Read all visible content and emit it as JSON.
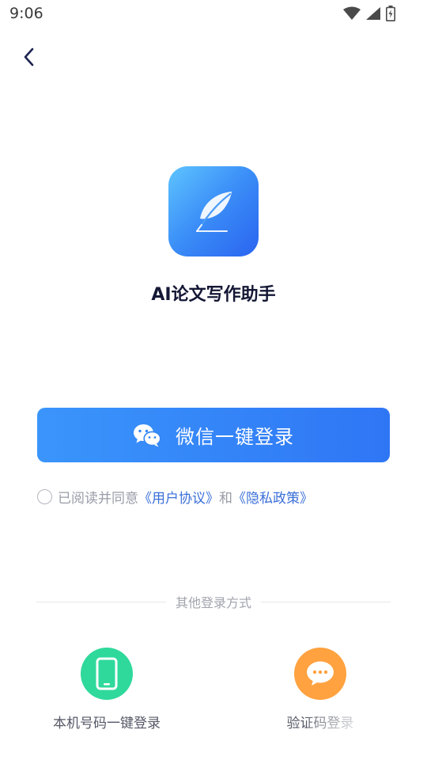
{
  "status_bar": {
    "time": "9:06",
    "icons": [
      "wifi-icon",
      "signal-icon",
      "battery-icon"
    ]
  },
  "nav": {
    "back_icon": "chevron-left-icon"
  },
  "app": {
    "name": "AI论文写作助手",
    "logo_icon": "feather-icon",
    "brand_color": "#3a8cf7"
  },
  "login": {
    "wechat_button_label": "微信一键登录",
    "wechat_icon": "wechat-icon"
  },
  "agreement": {
    "prefix": "已阅读并同意",
    "user_agreement": "《用户协议》",
    "conjunction": "和",
    "privacy_policy": "《隐私政策》",
    "checked": false
  },
  "other_login": {
    "divider_label": "其他登录方式",
    "options": [
      {
        "label": "本机号码一键登录",
        "icon": "phone-icon",
        "color": "#2fd99b"
      },
      {
        "label": "验证码登录",
        "icon": "chat-bubble-icon",
        "color": "#ffa23f"
      }
    ]
  }
}
